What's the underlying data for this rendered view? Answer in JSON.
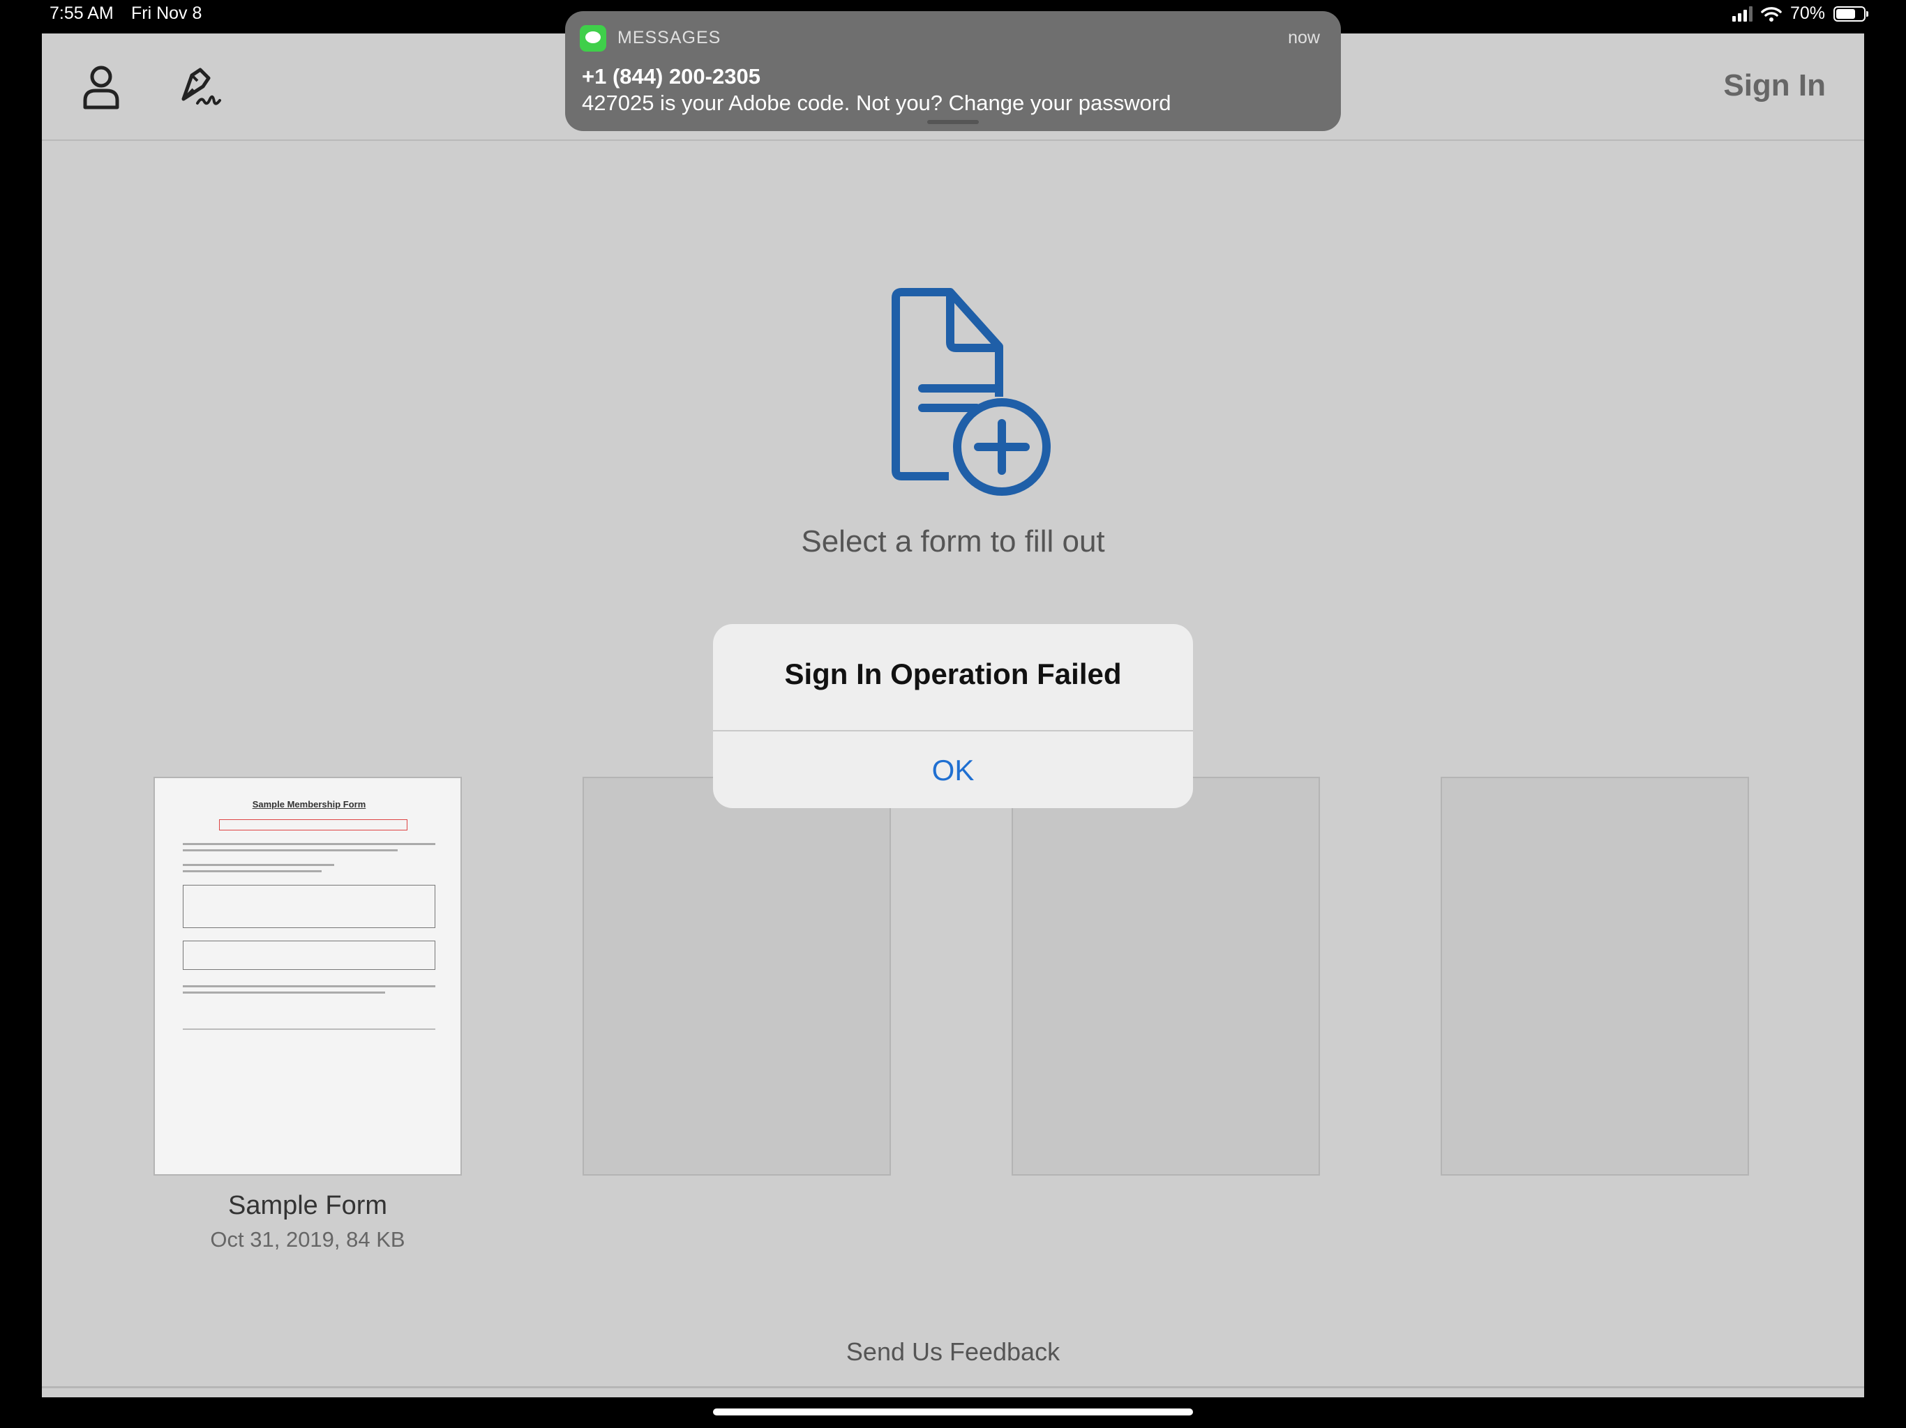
{
  "status_bar": {
    "time": "7:55 AM",
    "date": "Fri Nov 8",
    "battery": "70%",
    "battery_level": 0.7
  },
  "toolbar": {
    "sign_in_label": "Sign In",
    "profile_icon": "user-icon",
    "signature_icon": "pen-signature-icon"
  },
  "main": {
    "hero_icon": "document-add-icon",
    "select_prompt": "Select a form to fill out",
    "accent_color": "#1f5fa8"
  },
  "forms": [
    {
      "title": "Sample Form",
      "meta": "Oct 31, 2019, 84 KB",
      "thumbnail_title": "Sample Membership Form"
    }
  ],
  "feedback_label": "Send Us Feedback",
  "notification": {
    "app": "MESSAGES",
    "time": "now",
    "sender": "+1 (844) 200-2305",
    "body": "427025 is your Adobe code. Not you? Change your password"
  },
  "alert": {
    "title": "Sign In Operation Failed",
    "ok_label": "OK",
    "ok_color": "#1f6fd1"
  }
}
